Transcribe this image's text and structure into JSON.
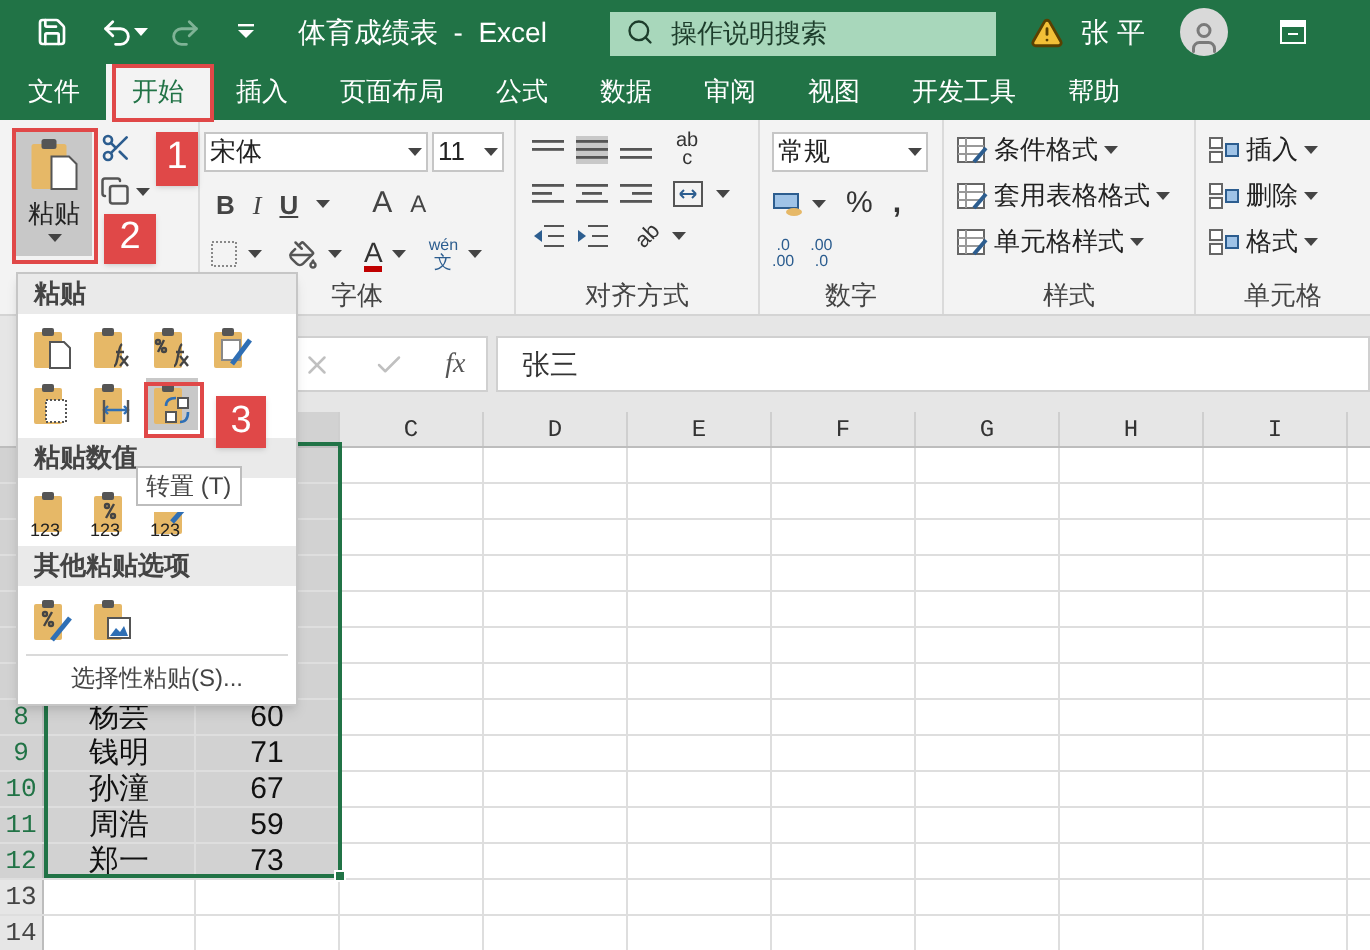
{
  "title_bar": {
    "document_title": "体育成绩表  -  Excel",
    "search": {
      "placeholder": "操作说明搜索"
    },
    "user": "张 平"
  },
  "tabs": [
    {
      "label": "文件",
      "selected": false
    },
    {
      "label": "开始",
      "selected": true
    },
    {
      "label": "插入",
      "selected": false
    },
    {
      "label": "页面布局",
      "selected": false
    },
    {
      "label": "公式",
      "selected": false
    },
    {
      "label": "数据",
      "selected": false
    },
    {
      "label": "审阅",
      "selected": false
    },
    {
      "label": "视图",
      "selected": false
    },
    {
      "label": "开发工具",
      "selected": false
    },
    {
      "label": "帮助",
      "selected": false
    }
  ],
  "ribbon": {
    "paste": {
      "label": "粘贴"
    },
    "font": {
      "name": "宋体",
      "size": "11",
      "bold": "B",
      "italic": "I",
      "underline": "U",
      "grow": "A",
      "shrink": "A",
      "font_color": "A",
      "phonetic_top": "wén",
      "phonetic_bottom": "文",
      "label": "字体"
    },
    "alignment": {
      "wrap_top": "ab",
      "wrap_bottom": "c",
      "orientation": "ab",
      "label": "对齐方式"
    },
    "number": {
      "format": "常规",
      "percent": "%",
      "comma": ",",
      "decimal_increase": [
        ".0",
        ".00"
      ],
      "decimal_decrease": [
        ".00",
        ".0"
      ],
      "label": "数字"
    },
    "styles": {
      "items": [
        "条件格式",
        "套用表格格式",
        "单元格样式"
      ],
      "label": "样式"
    },
    "cells": {
      "items": [
        "插入",
        "删除",
        "格式"
      ],
      "label": "单元格"
    }
  },
  "formula_bar": {
    "function_label": "fx",
    "value": "张三"
  },
  "paste_menu": {
    "sections": [
      {
        "title": "粘贴",
        "options": [
          {
            "kind": "page",
            "selected": false
          },
          {
            "kind": "formula",
            "selected": false
          },
          {
            "kind": "formula-percent",
            "selected": false
          },
          {
            "kind": "brush",
            "selected": false
          },
          {
            "kind": "dotted",
            "selected": false
          },
          {
            "kind": "widths",
            "selected": false
          },
          {
            "kind": "transpose",
            "selected": true
          }
        ]
      },
      {
        "title": "粘贴数值",
        "options": [
          {
            "kind": "values",
            "caption": "123",
            "selected": false
          },
          {
            "kind": "values-percent",
            "caption": "123",
            "selected": false
          },
          {
            "kind": "values-brush",
            "caption": "123",
            "selected": false
          }
        ]
      },
      {
        "title": "其他粘贴选项",
        "options": [
          {
            "kind": "percent-brush",
            "selected": false
          },
          {
            "kind": "picture",
            "selected": false
          }
        ]
      }
    ],
    "special": "选择性粘贴(S)...",
    "tooltip": "转置 (T)"
  },
  "sheet": {
    "columns": [
      "C",
      "D",
      "E",
      "F",
      "G",
      "H",
      "I"
    ],
    "rows": [
      {
        "selected": true
      },
      {
        "selected": true
      },
      {
        "selected": true
      },
      {
        "selected": true
      },
      {
        "selected": true
      },
      {
        "selected": true
      },
      {
        "selected": true
      },
      {
        "number": "8",
        "selected": true,
        "cells": [
          "杨芸",
          "60"
        ]
      },
      {
        "number": "9",
        "selected": true,
        "cells": [
          "钱明",
          "71"
        ]
      },
      {
        "number": "10",
        "selected": true,
        "cells": [
          "孙潼",
          "67"
        ]
      },
      {
        "number": "11",
        "selected": true,
        "cells": [
          "周浩",
          "59"
        ]
      },
      {
        "number": "12",
        "selected": true,
        "cells": [
          "郑一",
          "73"
        ]
      },
      {
        "number": "13",
        "selected": false
      },
      {
        "number": "14",
        "selected": false
      }
    ]
  },
  "callouts": [
    {
      "label": "1"
    },
    {
      "label": "2"
    },
    {
      "label": "3"
    }
  ]
}
